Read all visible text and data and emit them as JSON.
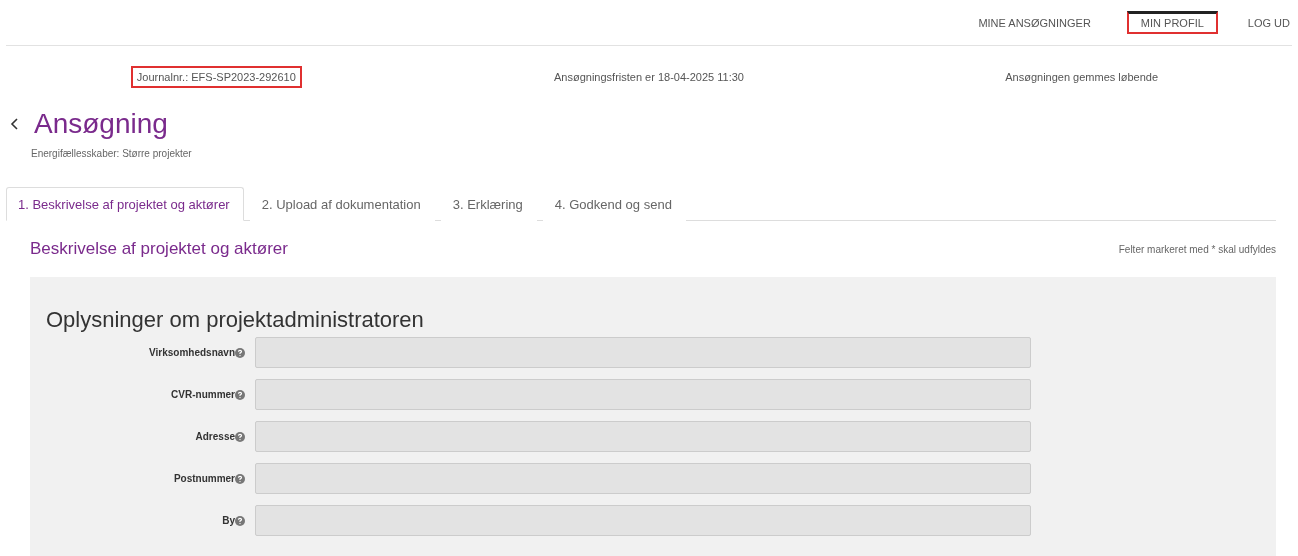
{
  "nav": [
    {
      "label": "MINE ANSØGNINGER",
      "highlighted": false
    },
    {
      "label": "MIN PROFIL",
      "highlighted": true
    },
    {
      "label": "LOG UD",
      "highlighted": false
    }
  ],
  "info": [
    {
      "text": "Journalnr.: EFS-SP2023-292610",
      "highlighted": true
    },
    {
      "text": "Ansøgningsfristen er 18-04-2025 11:30",
      "highlighted": false
    },
    {
      "text": "Ansøgningen gemmes løbende",
      "highlighted": false
    }
  ],
  "title": "Ansøgning",
  "subtitle": "Energifællesskaber: Større projekter",
  "tabs": [
    {
      "label": "1. Beskrivelse af projektet og aktører",
      "selected": true
    },
    {
      "label": "2. Upload af dokumentation",
      "selected": false
    },
    {
      "label": "3. Erklæring",
      "selected": false
    },
    {
      "label": "4. Godkend og send",
      "selected": false
    }
  ],
  "section_title": "Beskrivelse af projektet og aktører",
  "required_note": "Felter markeret med * skal udfyldes",
  "panel": {
    "heading": "Oplysninger om projektadministratoren",
    "fields": [
      {
        "label": "Virksomhedsnavn",
        "disabled": true
      },
      {
        "label": "CVR-nummer",
        "disabled": true
      },
      {
        "label": "Adresse",
        "disabled": true
      },
      {
        "label": "Postnummer",
        "disabled": true
      },
      {
        "label": "By",
        "disabled": true
      }
    ]
  }
}
